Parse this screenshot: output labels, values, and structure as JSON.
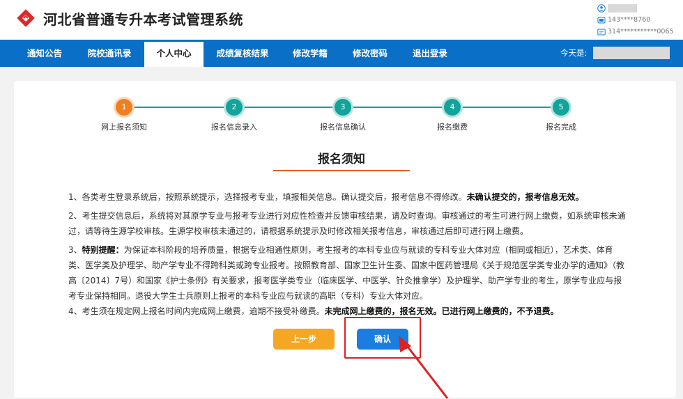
{
  "header": {
    "app_title": "河北省普通专升本考试管理系统",
    "user": {
      "phone": "143****8760",
      "id_number": "314***********0065"
    }
  },
  "nav": {
    "items": [
      {
        "label": "通知公告"
      },
      {
        "label": "院校通讯录"
      },
      {
        "label": "个人中心",
        "active": true
      },
      {
        "label": "成绩复核结果"
      },
      {
        "label": "修改学籍"
      },
      {
        "label": "修改密码"
      },
      {
        "label": "退出登录"
      }
    ],
    "today_label": "今天是:"
  },
  "steps": [
    {
      "num": "1",
      "label": "网上报名须知",
      "status": "current"
    },
    {
      "num": "2",
      "label": "报名信息录入",
      "status": "pending"
    },
    {
      "num": "3",
      "label": "报名信息确认",
      "status": "pending"
    },
    {
      "num": "4",
      "label": "报名缴费",
      "status": "pending"
    },
    {
      "num": "5",
      "label": "报名完成",
      "status": "pending"
    }
  ],
  "section_title": "报名须知",
  "notices": {
    "n1_text": "1、各类考生登录系统后，按照系统提示，选择报考专业，填报相关信息。确认提交后，报考信息不得修改。",
    "n1_bold": "未确认提交的，报考信息无效。",
    "n2_text": "2、考生提交信息后，系统将对其原学专业与报考专业进行对应性检查并反馈审核结果，请及时查询。审核通过的考生可进行网上缴费，如系统审核未通过，请等待生源学校审核。生源学校审核未通过的，请根据系统提示及时修改相关报考信息，审核通过后即可进行网上缴费。",
    "n3_prefix": "3、",
    "n3_bold": "特别提醒：",
    "n3_text": "为保证本科阶段的培养质量，根据专业相通性原则，考生报考的本科专业应与就读的专科专业大体对应（相同或相近），艺术类、体育类、医学类及护理学、助产学专业不得跨科类或跨专业报考。按照教育部、国家卫生计生委、国家中医药管理局《关于规范医学类专业办学的通知》（教高〔2014〕7号）和国家《护士条例》有关要求，报考医学类专业（临床医学、中医学、针灸推拿学）及护理学、助产学专业的考生，原学专业应与报考专业保持相同。退役大学生士兵原则上报考的本科专业应与就读的高职（专科）专业大体对应。",
    "n4_text": "4、考生须在规定网上报名时间内完成网上缴费，逾期不接受补缴费。",
    "n4_bold": "未完成网上缴费的，报名无效。已进行网上缴费的，不予退费。"
  },
  "buttons": {
    "prev": "上一步",
    "confirm": "确认"
  },
  "colors": {
    "nav_blue": "#0a6fc6",
    "step_active": "#f07f22",
    "step_pending": "#12a39a",
    "annotation_red": "#e02020"
  }
}
